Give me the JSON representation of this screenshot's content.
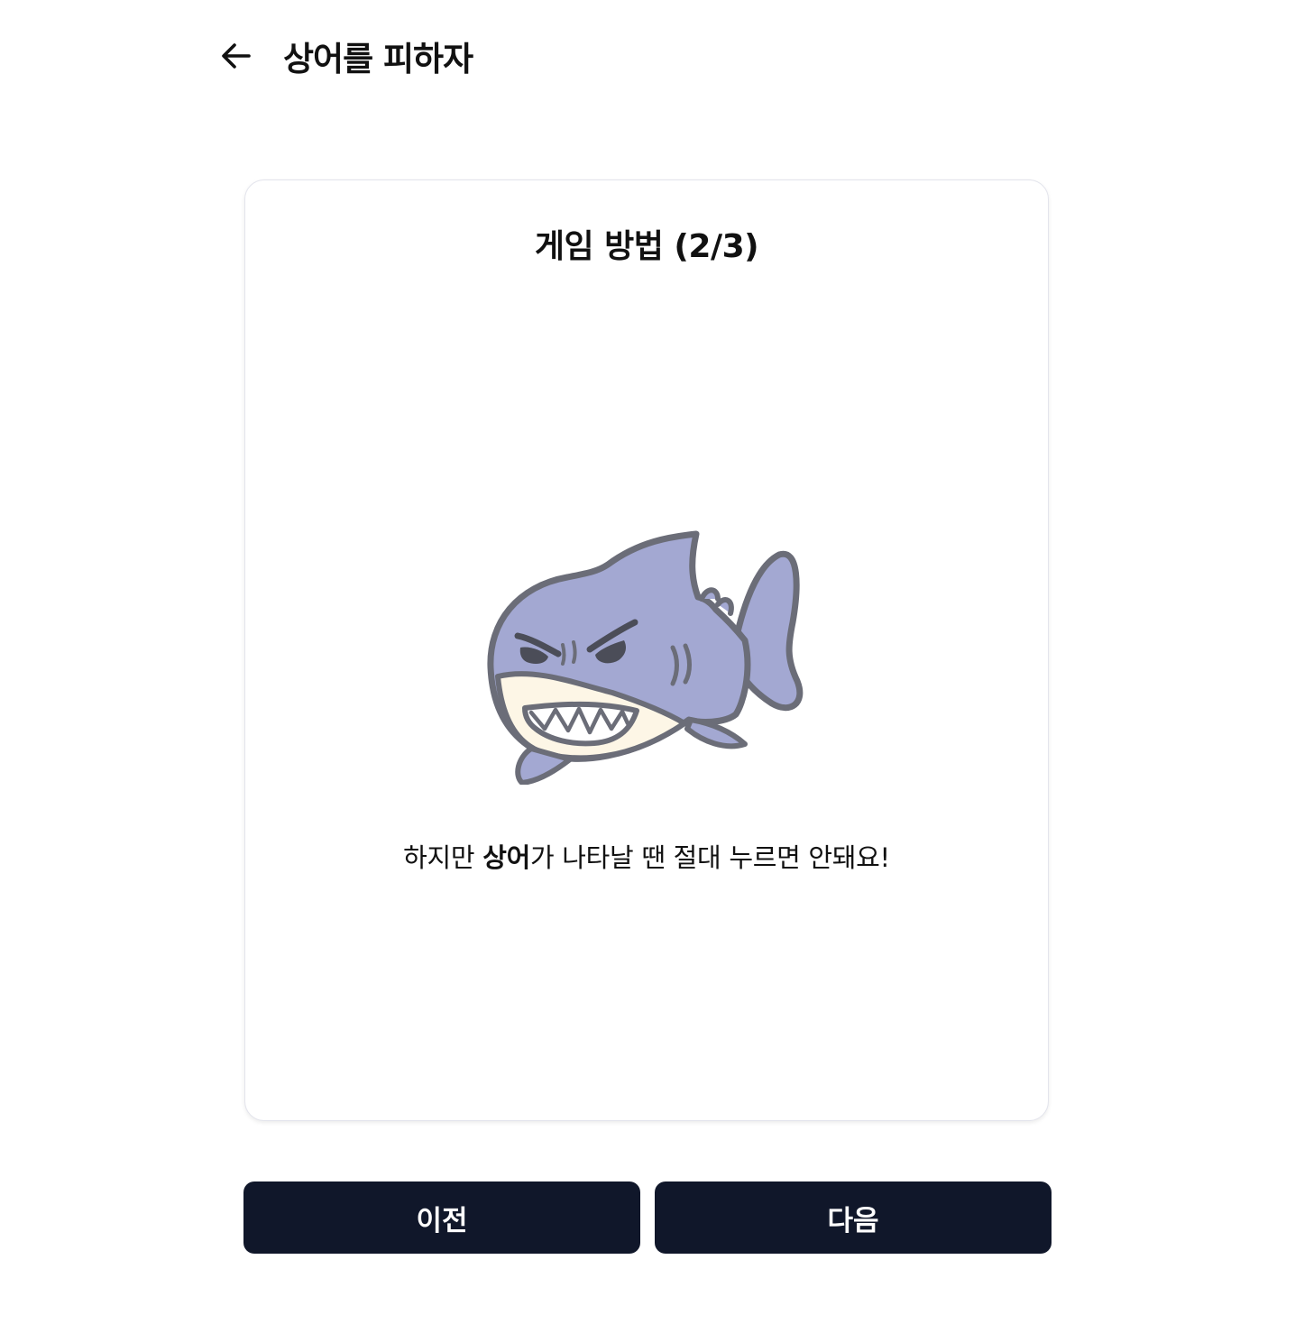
{
  "header": {
    "back_icon": "arrow-left-icon",
    "title": "상어를 피하자"
  },
  "card": {
    "title": "게임 방법 (2/3)",
    "image": "angry-shark-illustration",
    "description": {
      "before": "하지만 ",
      "emphasis": "상어",
      "after": "가 나타날 땐 절대 누르면 안돼요!"
    }
  },
  "buttons": {
    "prev_label": "이전",
    "next_label": "다음"
  },
  "colors": {
    "button_bg": "#10172a",
    "shark_body": "#a3a8d2",
    "shark_belly": "#fdf6e6",
    "shark_outline": "#6b6d78"
  }
}
